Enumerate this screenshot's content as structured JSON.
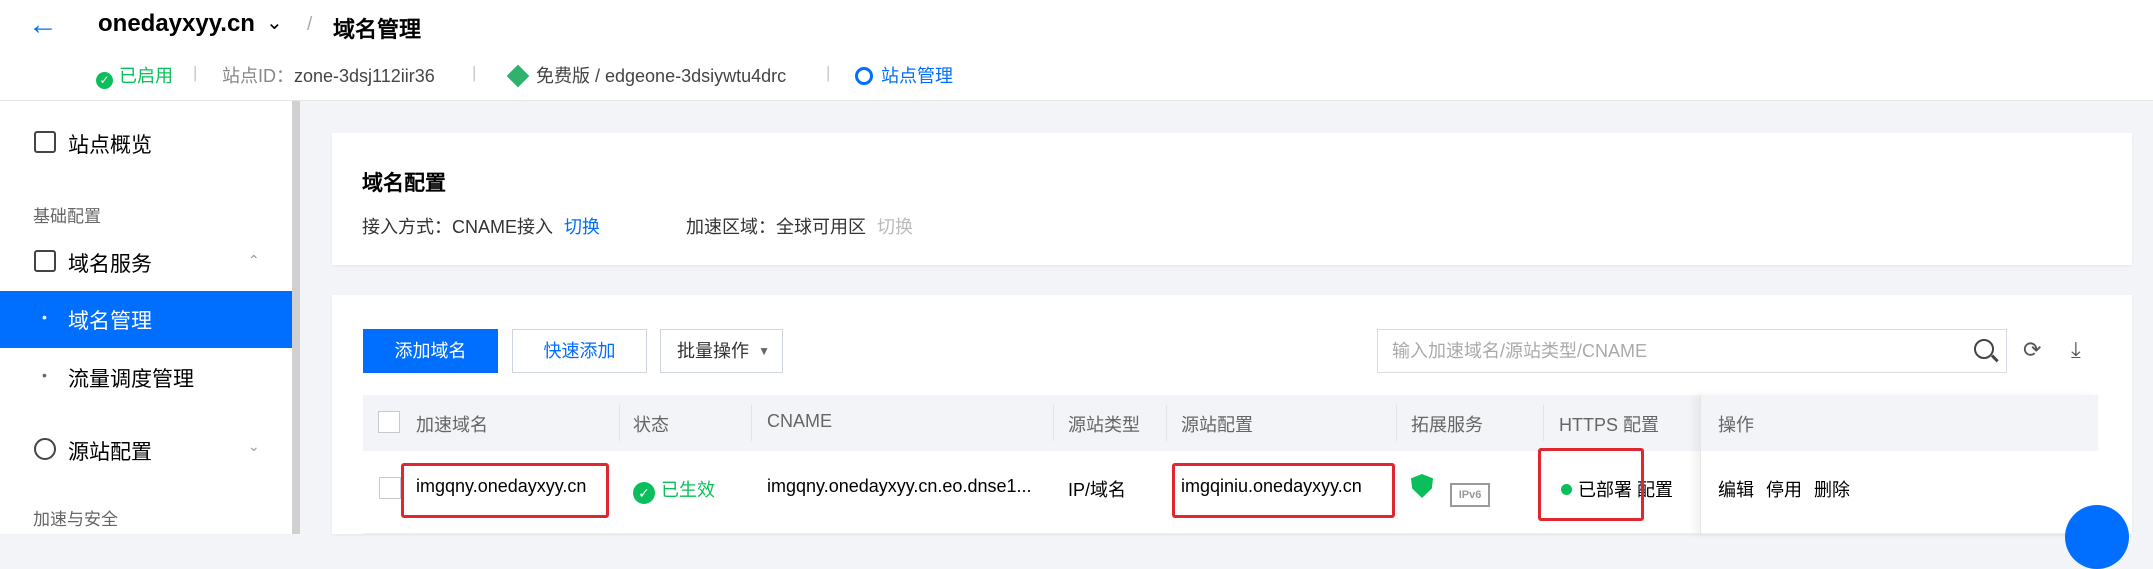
{
  "header": {
    "domain": "onedayxyy.cn",
    "page_title": "域名管理",
    "status": "已启用",
    "site_id_label": "站点ID：",
    "site_id": "zone-3dsj112iir36",
    "plan": "免费版 / edgeone-3dsiywtu4drc",
    "site_manage": "站点管理"
  },
  "sidebar": {
    "overview": "站点概览",
    "group_basic": "基础配置",
    "domain_service": "域名服务",
    "domain_manage": "域名管理",
    "traffic": "流量调度管理",
    "origin_config": "源站配置",
    "group_security": "加速与安全"
  },
  "config_card": {
    "title": "域名配置",
    "access_label": "接入方式：",
    "access_value": "CNAME接入",
    "access_switch": "切换",
    "region_label": "加速区域：",
    "region_value": "全球可用区",
    "region_switch": "切换"
  },
  "toolbar": {
    "add_domain": "添加域名",
    "quick_add": "快速添加",
    "batch": "批量操作",
    "search_placeholder": "输入加速域名/源站类型/CNAME"
  },
  "table": {
    "headers": [
      "加速域名",
      "状态",
      "CNAME",
      "源站类型",
      "源站配置",
      "拓展服务",
      "HTTPS 配置",
      "操作"
    ],
    "rows": [
      {
        "domain": "imgqny.onedayxyy.cn",
        "status": "已生效",
        "cname": "imgqny.onedayxyy.cn.eo.dnse1...",
        "origin_type": "IP/域名",
        "origin_config": "imgqiniu.onedayxyy.cn",
        "ipv6": "IPv6",
        "https": "已部署",
        "https_link": "配置",
        "op_edit": "编辑",
        "op_disable": "停用",
        "op_delete": "删除"
      }
    ]
  },
  "colors": {
    "primary": "#006eff",
    "success": "#0abf5b",
    "highlight": "#e0262f"
  }
}
